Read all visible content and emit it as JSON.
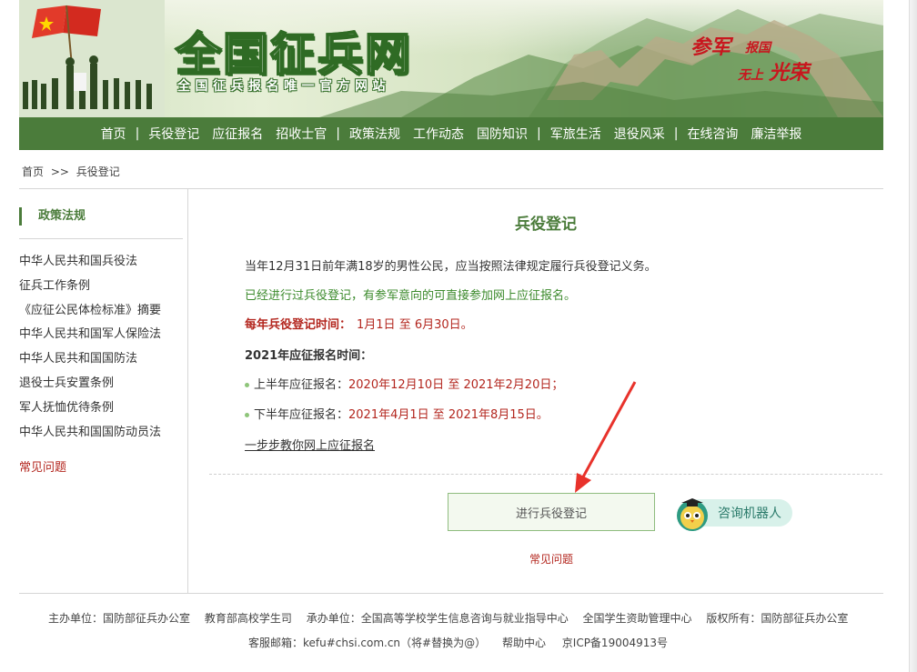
{
  "banner": {
    "title": "全国征兵网",
    "subtitle": "全国征兵报名唯一官方网站",
    "slogan": [
      "参军",
      "报国",
      "无上",
      "光荣"
    ]
  },
  "nav": {
    "items": [
      "首页",
      "兵役登记",
      "应征报名",
      "招收士官",
      "政策法规",
      "工作动态",
      "国防知识",
      "军旅生活",
      "退役风采",
      "在线咨询",
      "廉洁举报"
    ],
    "separator": "|"
  },
  "breadcrumb": {
    "home": "首页",
    "sep": ">>",
    "current": "兵役登记"
  },
  "sidebar": {
    "title": "政策法规",
    "items": [
      "中华人民共和国兵役法",
      "征兵工作条例",
      "《应征公民体检标准》摘要",
      "中华人民共和国军人保险法",
      "中华人民共和国国防法",
      "退役士兵安置条例",
      "军人抚恤优待条例",
      "中华人民共和国国防动员法"
    ],
    "faq": "常见问题"
  },
  "main": {
    "title": "兵役登记",
    "p1": "当年12月31日前年满18岁的男性公民，应当按照法律规定履行兵役登记义务。",
    "p2": "已经进行过兵役登记，有参军意向的可直接参加网上应征报名。",
    "register_time_label": "每年兵役登记时间：",
    "register_time_value": "1月1日 至 6月30日。",
    "enlist_label": "2021年应征报名时间：",
    "first_half_label": "上半年应征报名：",
    "first_half_value": "2020年12月10日 至 2021年2月20日；",
    "second_half_label": "下半年应征报名：",
    "second_half_value": "2021年4月1日 至 2021年8月15日。",
    "guide_link": "一步步教你网上应征报名",
    "register_button": "进行兵役登记",
    "robot_label": "咨询机器人",
    "faq_link": "常见问题"
  },
  "footer": {
    "line1": [
      "主办单位：国防部征兵办公室",
      "教育部高校学生司",
      "承办单位：全国高等学校学生信息咨询与就业指导中心",
      "全国学生资助管理中心",
      "版权所有：国防部征兵办公室"
    ],
    "line2": [
      "客服邮箱：kefu#chsi.com.cn（将#替换为@）",
      "帮助中心",
      "京ICP备19004913号"
    ]
  },
  "colors": {
    "brand_green": "#4b7c3b",
    "accent_red": "#b3261e",
    "link_green": "#3c8a2c"
  }
}
